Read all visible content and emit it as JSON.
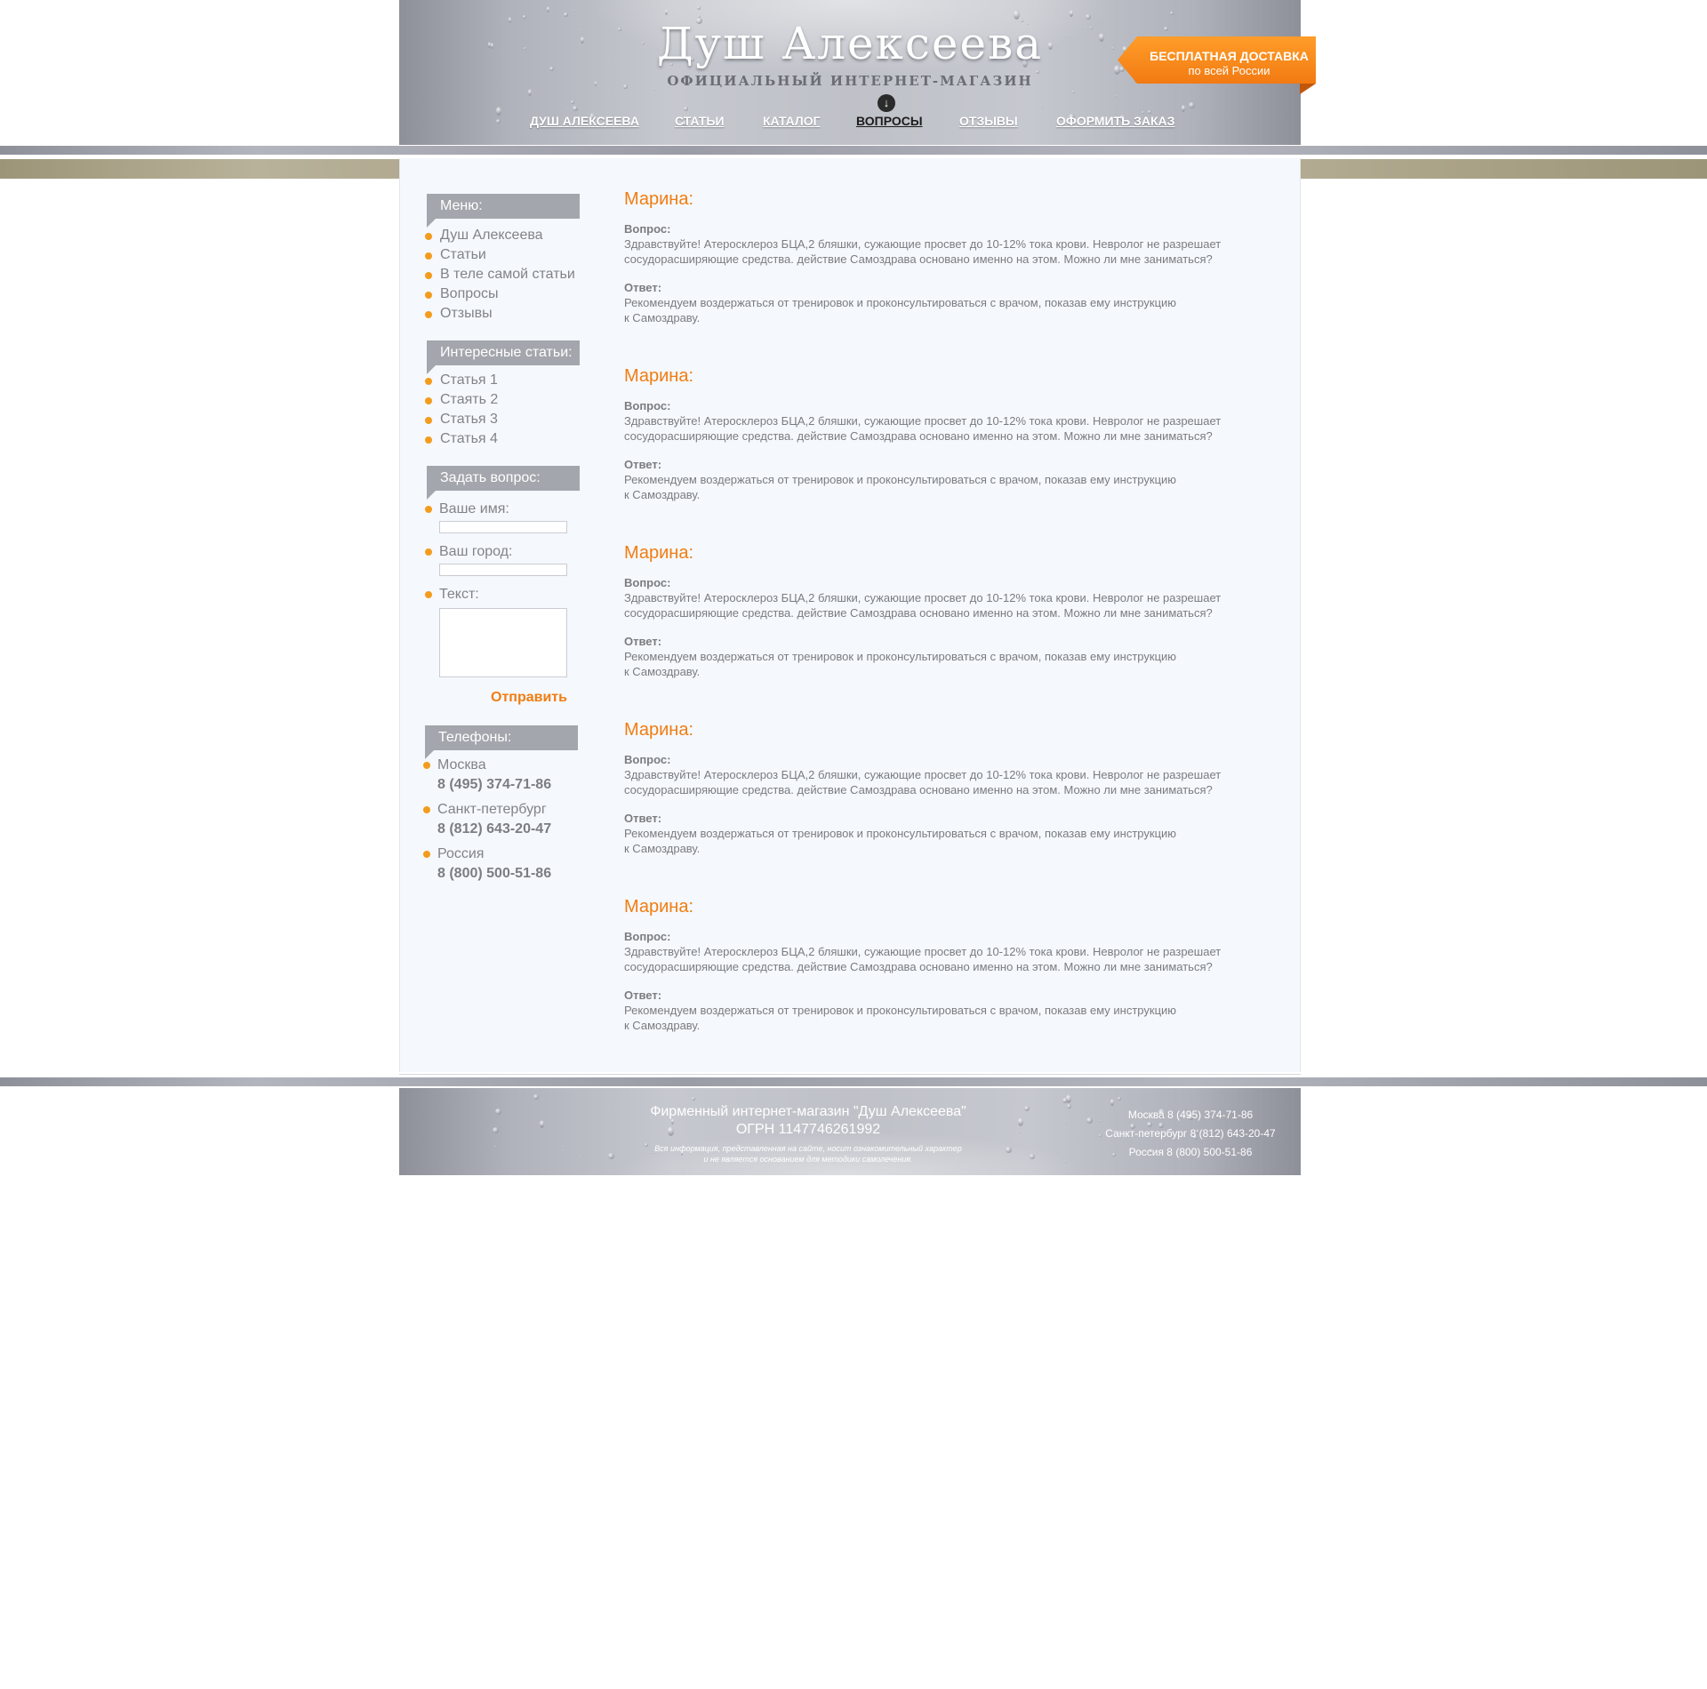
{
  "header": {
    "title": "Душ Алексеева",
    "subtitle": "ОФИЦИАЛЬНЫЙ ИНТЕРНЕТ-МАГАЗИН",
    "nav": [
      {
        "label": "ДУШ АЛЕКСЕЕВА"
      },
      {
        "label": "СТАТЬИ"
      },
      {
        "label": "КАТАЛОГ"
      },
      {
        "label": "ВОПРОСЫ",
        "active": true
      },
      {
        "label": "ОТЗЫВЫ"
      },
      {
        "label": "ОФОРМИТЬ ЗАКАЗ"
      }
    ],
    "active_marker_icon": "arrow-down-circle-icon",
    "delivery_badge": {
      "line1": "БЕСПЛАТНАЯ ДОСТАВКА",
      "line2": "по всей России"
    }
  },
  "sidebar": {
    "menu": {
      "title": "Меню:",
      "items": [
        "Душ Алексеева",
        "Статьи",
        "В теле самой статьи",
        "Вопросы",
        "Отзывы"
      ]
    },
    "articles": {
      "title": "Интересные статьи:",
      "items": [
        "Статья 1",
        "Стаять 2",
        "Статья 3",
        "Статья 4"
      ]
    },
    "ask": {
      "title": "Задать вопрос:",
      "name_label": "Ваше имя:",
      "city_label": "Ваш город:",
      "text_label": "Текст:",
      "name_value": "",
      "city_value": "",
      "text_value": "",
      "submit_label": "Отправить"
    },
    "phones": {
      "title": "Телефоны:",
      "items": [
        {
          "city": "Москва",
          "number": "8 (495) 374-71-86"
        },
        {
          "city": "Санкт-петербург",
          "number": "8 (812) 643-20-47"
        },
        {
          "city": "Россия",
          "number": "8 (800) 500-51-86"
        }
      ]
    }
  },
  "questions": [
    {
      "name": "Марина:",
      "question_label": "Вопрос:",
      "question_lines": [
        "Здравствуйте! Атеросклероз БЦА,2 бляшки, сужающие просвет до 10-12% тока крови. Невролог не разрешает",
        "сосудорасширяющие средства. действие Самоздрава основано именно на этом. Можно ли мне заниматься?"
      ],
      "answer_label": "Ответ:",
      "answer_lines": [
        "Рекомендуем воздержаться от тренировок и проконсультироваться с врачом, показав ему инструкцию",
        "к Самоздраву."
      ]
    },
    {
      "name": "Марина:",
      "question_label": "Вопрос:",
      "question_lines": [
        "Здравствуйте! Атеросклероз БЦА,2 бляшки, сужающие просвет до 10-12% тока крови. Невролог не разрешает",
        "сосудорасширяющие средства. действие Самоздрава основано именно на этом. Можно ли мне заниматься?"
      ],
      "answer_label": "Ответ:",
      "answer_lines": [
        "Рекомендуем воздержаться от тренировок и проконсультироваться с врачом, показав ему инструкцию",
        "к Самоздраву."
      ]
    },
    {
      "name": "Марина:",
      "question_label": "Вопрос:",
      "question_lines": [
        "Здравствуйте! Атеросклероз БЦА,2 бляшки, сужающие просвет до 10-12% тока крови. Невролог не разрешает",
        "сосудорасширяющие средства. действие Самоздрава основано именно на этом. Можно ли мне заниматься?"
      ],
      "answer_label": "Ответ:",
      "answer_lines": [
        "Рекомендуем воздержаться от тренировок и проконсультироваться с врачом, показав ему инструкцию",
        "к Самоздраву."
      ]
    },
    {
      "name": "Марина:",
      "question_label": "Вопрос:",
      "question_lines": [
        "Здравствуйте! Атеросклероз БЦА,2 бляшки, сужающие просвет до 10-12% тока крови. Невролог не разрешает",
        "сосудорасширяющие средства. действие Самоздрава основано именно на этом. Можно ли мне заниматься?"
      ],
      "answer_label": "Ответ:",
      "answer_lines": [
        "Рекомендуем воздержаться от тренировок и проконсультироваться с врачом, показав ему инструкцию",
        "к Самоздраву."
      ]
    },
    {
      "name": "Марина:",
      "question_label": "Вопрос:",
      "question_lines": [
        "Здравствуйте! Атеросклероз БЦА,2 бляшки, сужающие просвет до 10-12% тока крови. Невролог не разрешает",
        "сосудорасширяющие средства. действие Самоздрава основано именно на этом. Можно ли мне заниматься?"
      ],
      "answer_label": "Ответ:",
      "answer_lines": [
        "Рекомендуем воздержаться от тренировок и проконсультироваться с врачом, показав ему инструкцию",
        "к Самоздраву."
      ]
    }
  ],
  "footer": {
    "title": "Фирменный интернет-магазин \"Душ Алексеева\"",
    "ogrn": "ОГРН 1147746261992",
    "note_line1": "Вся информация, представленная на сайте, носит ознакомительный характер",
    "note_line2": "и не является основанием для методики самолечения.",
    "phones": [
      "Москва 8 (495) 374-71-86",
      "Санкт-петербург 8 (812) 643-20-47",
      "Россия 8 (800) 500-51-86"
    ]
  },
  "colors": {
    "accent": "#f07d12",
    "bullet": "#f39c1c",
    "panel": "#a3a6ac",
    "content_bg": "#f5f8fc"
  }
}
